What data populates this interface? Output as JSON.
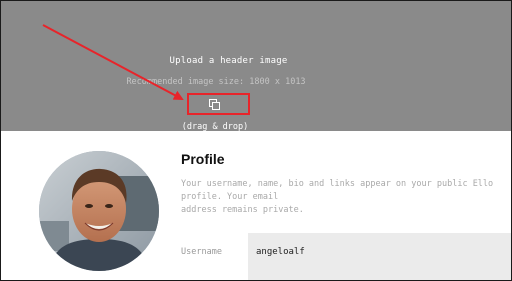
{
  "header_upload": {
    "title": "Upload a header image",
    "recommended_size": "Recommended image size: 1800 x 1013",
    "drag_drop": "(drag & drop)",
    "upload_icon": "copy-upload-icon"
  },
  "annotation": {
    "color": "#e8242a"
  },
  "profile": {
    "title": "Profile",
    "description": "Your username, name, bio and links appear on your public Ello profile. Your email\naddress remains private.",
    "username_label": "Username",
    "username_value": "angeloalf"
  },
  "colors": {
    "header_bg": "#8a8a8a",
    "field_bg": "#ebebeb"
  }
}
